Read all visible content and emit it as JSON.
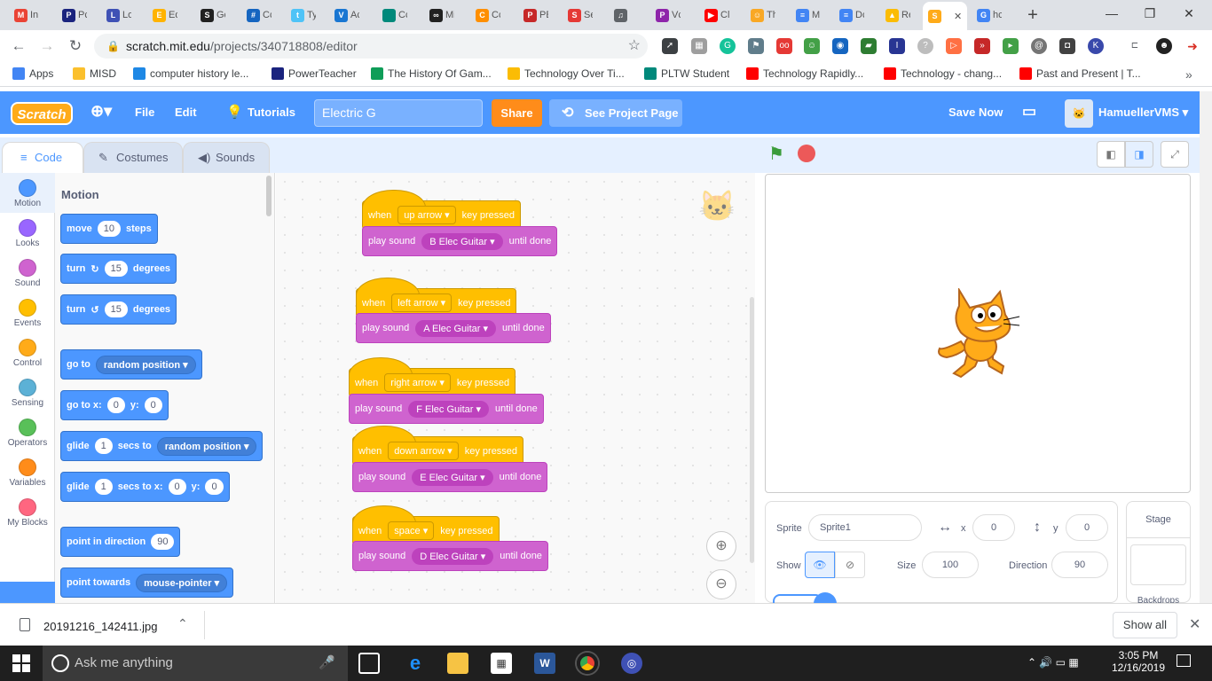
{
  "browser": {
    "tabs": [
      {
        "label": "In",
        "icon": "gmail-icon",
        "color": "#ea4335",
        "glyph": "M"
      },
      {
        "label": "Pc",
        "icon": "powerteacher-icon",
        "color": "#1a237e",
        "glyph": "P"
      },
      {
        "label": "Lo",
        "icon": "shield-icon",
        "color": "#3f51b5",
        "glyph": "L"
      },
      {
        "label": "Ed",
        "icon": "edpuzzle-icon",
        "color": "#ffb300",
        "glyph": "E"
      },
      {
        "label": "Gc",
        "icon": "s-icon",
        "color": "#212121",
        "glyph": "S"
      },
      {
        "label": "Cc",
        "icon": "grid-icon",
        "color": "#1565c0",
        "glyph": "#"
      },
      {
        "label": "Ty",
        "icon": "t-icon",
        "color": "#4fc3f7",
        "glyph": "t"
      },
      {
        "label": "Ac",
        "icon": "v-icon",
        "color": "#1976d2",
        "glyph": "V"
      },
      {
        "label": "Cc",
        "icon": "pltw-icon",
        "color": "#00897b",
        "glyph": ""
      },
      {
        "label": "Mi",
        "icon": "ghost-icon",
        "color": "#212121",
        "glyph": "∞"
      },
      {
        "label": "Cc",
        "icon": "c-icon",
        "color": "#ff8f00",
        "glyph": "C"
      },
      {
        "label": "PE",
        "icon": "pe-icon",
        "color": "#c62828",
        "glyph": "P"
      },
      {
        "label": "Se",
        "icon": "s-red-icon",
        "color": "#e53935",
        "glyph": "S"
      },
      {
        "label": "",
        "icon": "headphones-icon",
        "color": "#5f6368",
        "glyph": "♫"
      },
      {
        "label": "Vc",
        "icon": "picsart-icon",
        "color": "#8e24aa",
        "glyph": "P"
      },
      {
        "label": "Cl",
        "icon": "youtube-icon",
        "color": "#ff0000",
        "glyph": "▶"
      },
      {
        "label": "Th",
        "icon": "face-icon",
        "color": "#f9a825",
        "glyph": "☺"
      },
      {
        "label": "M",
        "icon": "docs-icon",
        "color": "#4285f4",
        "glyph": "≡"
      },
      {
        "label": "Dc",
        "icon": "docs-icon",
        "color": "#4285f4",
        "glyph": "≡"
      },
      {
        "label": "Re",
        "icon": "drive-icon",
        "color": "#fbbc04",
        "glyph": "▲"
      },
      {
        "label": "",
        "icon": "scratch-icon",
        "color": "#ffab19",
        "glyph": "S",
        "active": true
      },
      {
        "label": "hc",
        "icon": "google-icon",
        "color": "#4285f4",
        "glyph": "G"
      }
    ],
    "url_domain": "scratch.mit.edu",
    "url_path": "/projects/340718808/editor",
    "bookmarks": [
      {
        "label": "Apps",
        "color": "#4285f4"
      },
      {
        "label": "MISD",
        "color": "#fbc02d"
      },
      {
        "label": "computer history le...",
        "color": "#1e88e5"
      },
      {
        "label": "PowerTeacher",
        "color": "#1a237e"
      },
      {
        "label": "The History Of Gam...",
        "color": "#0f9d58"
      },
      {
        "label": "Technology Over Ti...",
        "color": "#fbbc04"
      },
      {
        "label": "PLTW Student",
        "color": "#00897b"
      },
      {
        "label": "Technology Rapidly...",
        "color": "#ff0000"
      },
      {
        "label": "Technology - chang...",
        "color": "#ff0000"
      },
      {
        "label": "Past and Present | T...",
        "color": "#ff0000"
      }
    ]
  },
  "scratch": {
    "logo": "Scratch",
    "menu": {
      "file": "File",
      "edit": "Edit",
      "tutorials": "Tutorials",
      "project_title": "Electric G",
      "share": "Share",
      "see_project": "See Project Page",
      "save_now": "Save Now",
      "username": "HamuellerVMS"
    },
    "tabs": {
      "code": "Code",
      "costumes": "Costumes",
      "sounds": "Sounds"
    },
    "categories": [
      {
        "label": "Motion",
        "color": "#4c97ff"
      },
      {
        "label": "Looks",
        "color": "#9966ff"
      },
      {
        "label": "Sound",
        "color": "#cf63cf"
      },
      {
        "label": "Events",
        "color": "#ffbf00"
      },
      {
        "label": "Control",
        "color": "#ffab19"
      },
      {
        "label": "Sensing",
        "color": "#5cb1d6"
      },
      {
        "label": "Operators",
        "color": "#59c059"
      },
      {
        "label": "Variables",
        "color": "#ff8c1a"
      },
      {
        "label": "My Blocks",
        "color": "#ff6680"
      }
    ],
    "palette": {
      "heading": "Motion",
      "move": {
        "a": "move",
        "v": "10",
        "b": "steps"
      },
      "turn_right": {
        "a": "turn",
        "v": "15",
        "b": "degrees"
      },
      "turn_left": {
        "a": "turn",
        "v": "15",
        "b": "degrees"
      },
      "goto": {
        "a": "go to",
        "dd": "random position"
      },
      "goto_xy": {
        "a": "go to x:",
        "x": "0",
        "b": "y:",
        "y": "0"
      },
      "glide_to": {
        "a": "glide",
        "v": "1",
        "b": "secs to",
        "dd": "random position"
      },
      "glide_xy": {
        "a": "glide",
        "v": "1",
        "b": "secs to x:",
        "x": "0",
        "c": "y:",
        "y": "0"
      },
      "point_dir": {
        "a": "point in direction",
        "v": "90"
      },
      "point_towards": {
        "a": "point towards",
        "dd": "mouse-pointer"
      }
    },
    "scripts": [
      {
        "when": "when",
        "key": "up arrow",
        "pressed": "key pressed",
        "play": "play sound",
        "sound": "B Elec Guitar",
        "until": "until done"
      },
      {
        "when": "when",
        "key": "left arrow",
        "pressed": "key pressed",
        "play": "play sound",
        "sound": "A Elec Guitar",
        "until": "until done"
      },
      {
        "when": "when",
        "key": "right arrow",
        "pressed": "key pressed",
        "play": "play sound",
        "sound": "F Elec Guitar",
        "until": "until done"
      },
      {
        "when": "when",
        "key": "down arrow",
        "pressed": "key pressed",
        "play": "play sound",
        "sound": "E Elec Guitar",
        "until": "until done"
      },
      {
        "when": "when",
        "key": "space",
        "pressed": "key pressed",
        "play": "play sound",
        "sound": "D Elec Guitar",
        "until": "until done"
      }
    ],
    "sprite_info": {
      "sprite_label": "Sprite",
      "sprite_name": "Sprite1",
      "x_label": "x",
      "x": "0",
      "y_label": "y",
      "y": "0",
      "show_label": "Show",
      "size_label": "Size",
      "size": "100",
      "direction_label": "Direction",
      "direction": "90"
    },
    "stage_panel": {
      "title": "Stage",
      "backdrops": "Backdrops"
    }
  },
  "download": {
    "filename": "20191216_142411.jpg",
    "show_all": "Show all"
  },
  "taskbar": {
    "search_placeholder": "Ask me anything",
    "time": "3:05 PM",
    "date": "12/16/2019"
  }
}
